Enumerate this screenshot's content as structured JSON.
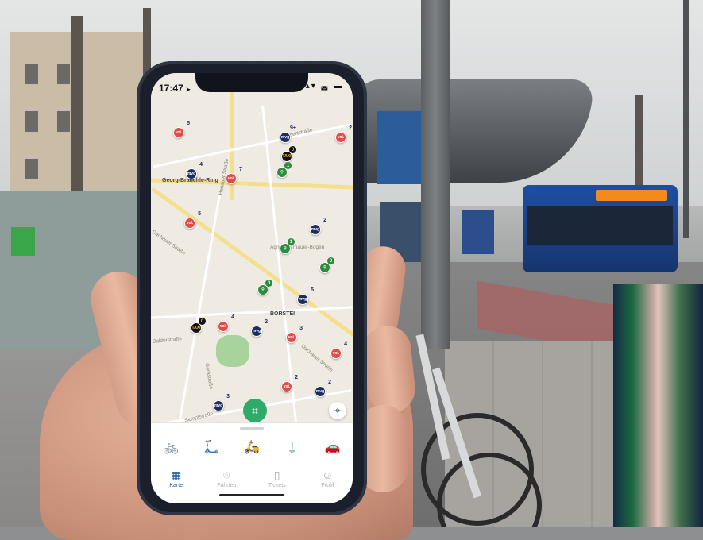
{
  "status": {
    "time": "17:47",
    "location_arrow": "➤",
    "icons": "▴▾ ◛ ▬"
  },
  "map": {
    "streets": [
      {
        "id": "georg",
        "text": "Georg-Brauchle-Ring"
      },
      {
        "id": "dachauer",
        "text": "Dachauer Straße"
      },
      {
        "id": "dachauer2",
        "text": "Dachauer Straße"
      },
      {
        "id": "hanauer",
        "text": "Hanauer Straße"
      },
      {
        "id": "baldurstr",
        "text": "Baldurstraße"
      },
      {
        "id": "borstei",
        "text": "BORSTEI"
      },
      {
        "id": "agnes",
        "text": "Agnes-Bernauer-Bogen"
      },
      {
        "id": "sempt",
        "text": "Semptstraße"
      },
      {
        "id": "ebert",
        "text": "Ebertstraße"
      },
      {
        "id": "gerastr",
        "text": "Gerastraße"
      }
    ],
    "pins": [
      {
        "type": "voi",
        "label": "voi.",
        "count": "5"
      },
      {
        "type": "mvg",
        "label": "mvg",
        "count": "9+"
      },
      {
        "type": "voi",
        "label": "voi.",
        "count": "2"
      },
      {
        "type": "taxi",
        "label": "TAXI",
        "count": "0"
      },
      {
        "type": "bike",
        "label": "⚲",
        "count": "1"
      },
      {
        "type": "voi",
        "label": "voi.",
        "count": "7"
      },
      {
        "type": "mvg",
        "label": "mvg",
        "count": "4"
      },
      {
        "type": "voi",
        "label": "voi.",
        "count": "5"
      },
      {
        "type": "mvg",
        "label": "mvg",
        "count": "2"
      },
      {
        "type": "bike",
        "label": "⚲",
        "count": "1"
      },
      {
        "type": "bike",
        "label": "⚲",
        "count": "0"
      },
      {
        "type": "bike",
        "label": "⚲",
        "count": "0"
      },
      {
        "type": "mvg",
        "label": "mvg",
        "count": "5"
      },
      {
        "type": "taxi",
        "label": "TAXI",
        "count": "0"
      },
      {
        "type": "voi",
        "label": "voi.",
        "count": "4"
      },
      {
        "type": "mvg",
        "label": "mvg",
        "count": "2"
      },
      {
        "type": "voi",
        "label": "voi.",
        "count": "3"
      },
      {
        "type": "voi",
        "label": "voi.",
        "count": "4"
      },
      {
        "type": "mvg",
        "label": "mvg",
        "count": "2"
      },
      {
        "type": "voi",
        "label": "voi.",
        "count": "2"
      },
      {
        "type": "mvg",
        "label": "mvg",
        "count": "3"
      }
    ]
  },
  "scan_button_icon": "⌗",
  "locate_icon": "⌖",
  "modes": [
    {
      "name": "bike",
      "glyph": "🚲"
    },
    {
      "name": "scooter",
      "glyph": "🛴"
    },
    {
      "name": "moped",
      "glyph": "🛵"
    },
    {
      "name": "station",
      "glyph": "⏚"
    },
    {
      "name": "car",
      "glyph": "🚗"
    }
  ],
  "tabs": [
    {
      "label": "Karte",
      "icon": "▦",
      "active": true
    },
    {
      "label": "Fahrten",
      "icon": "⌾",
      "active": false
    },
    {
      "label": "Tickets",
      "icon": "▯",
      "active": false
    },
    {
      "label": "Profil",
      "icon": "☺",
      "active": false
    }
  ],
  "colors": {
    "voi": "#e24b48",
    "mvg": "#1c2c5c",
    "bike": "#2e8b3c",
    "accent": "#1c5b9a",
    "fab": "#2eaa6b"
  }
}
